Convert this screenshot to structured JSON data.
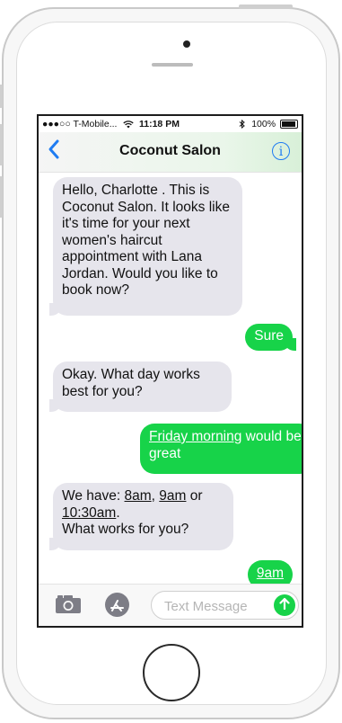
{
  "status": {
    "carrier": "●●●○○ T-Mobile...",
    "wifi_icon": "wifi-icon",
    "time": "11:18 PM",
    "bluetooth_icon": "bluetooth-icon",
    "battery": "100%"
  },
  "nav": {
    "back_icon": "chevron-left-icon",
    "title": "Coconut Salon",
    "info_icon": "info-icon"
  },
  "messages": [
    {
      "from": "them",
      "text": "Hello, Charlotte . This is Coconut Salon. It looks like it's time for your next women's haircut appointment with Lana Jordan. Would you like to book now?"
    },
    {
      "from": "me",
      "text": "Sure"
    },
    {
      "from": "them",
      "text": "Okay. What day works best for you?"
    },
    {
      "from": "me",
      "link": "Friday morning",
      "rest": " would be great"
    },
    {
      "from": "them",
      "line1_prefix": "We have: ",
      "opt1": "8am",
      "sep1": ", ",
      "opt2": "9am",
      "sep2": " or",
      "opt3": "10:30am",
      "line2_end": ".",
      "line3": "What works for you?"
    },
    {
      "from": "me",
      "link": "9am"
    }
  ],
  "compose": {
    "camera_icon": "camera-icon",
    "apps_icon": "app-store-icon",
    "placeholder": "Text Message",
    "send_icon": "arrow-up-icon"
  },
  "colors": {
    "accent_blue": "#1f7cf2",
    "bubble_green": "#17d349",
    "bubble_gray": "#e6e5ec"
  }
}
